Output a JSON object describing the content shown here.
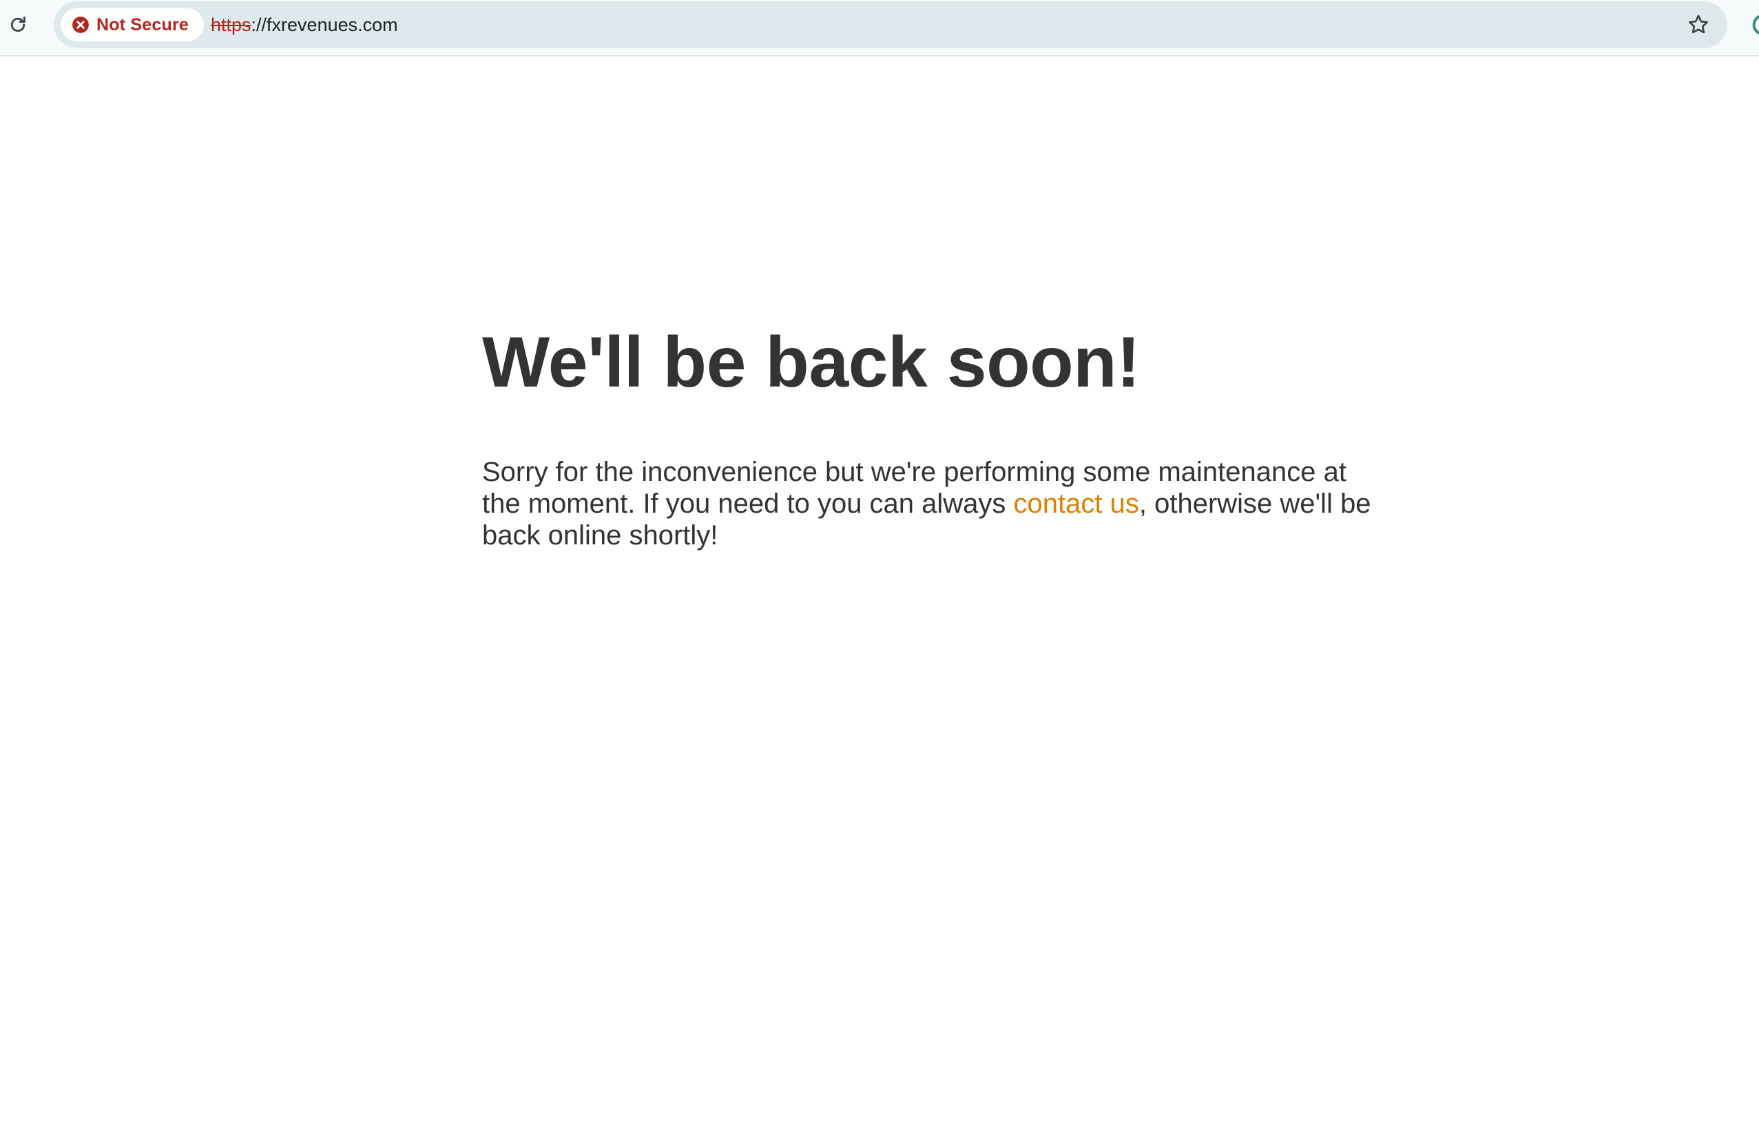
{
  "browser": {
    "security_label": "Not Secure",
    "url_scheme": "https",
    "url_rest": "://fxrevenues.com",
    "icons": {
      "reload": "reload-icon",
      "security": "error-circle-icon",
      "bookmark": "star-outline-icon"
    },
    "colors": {
      "security_red": "#b3261e",
      "omnibox_bg": "#dde9ec"
    }
  },
  "page": {
    "heading": "We'll be back soon!",
    "message_before_link": "Sorry for the inconvenience but we're performing some maintenance at the moment. If you need to you can always ",
    "link_text": "contact us",
    "message_after_link": ", otherwise we'll be back online shortly!",
    "colors": {
      "text": "#333333",
      "link": "#dc8100"
    }
  }
}
